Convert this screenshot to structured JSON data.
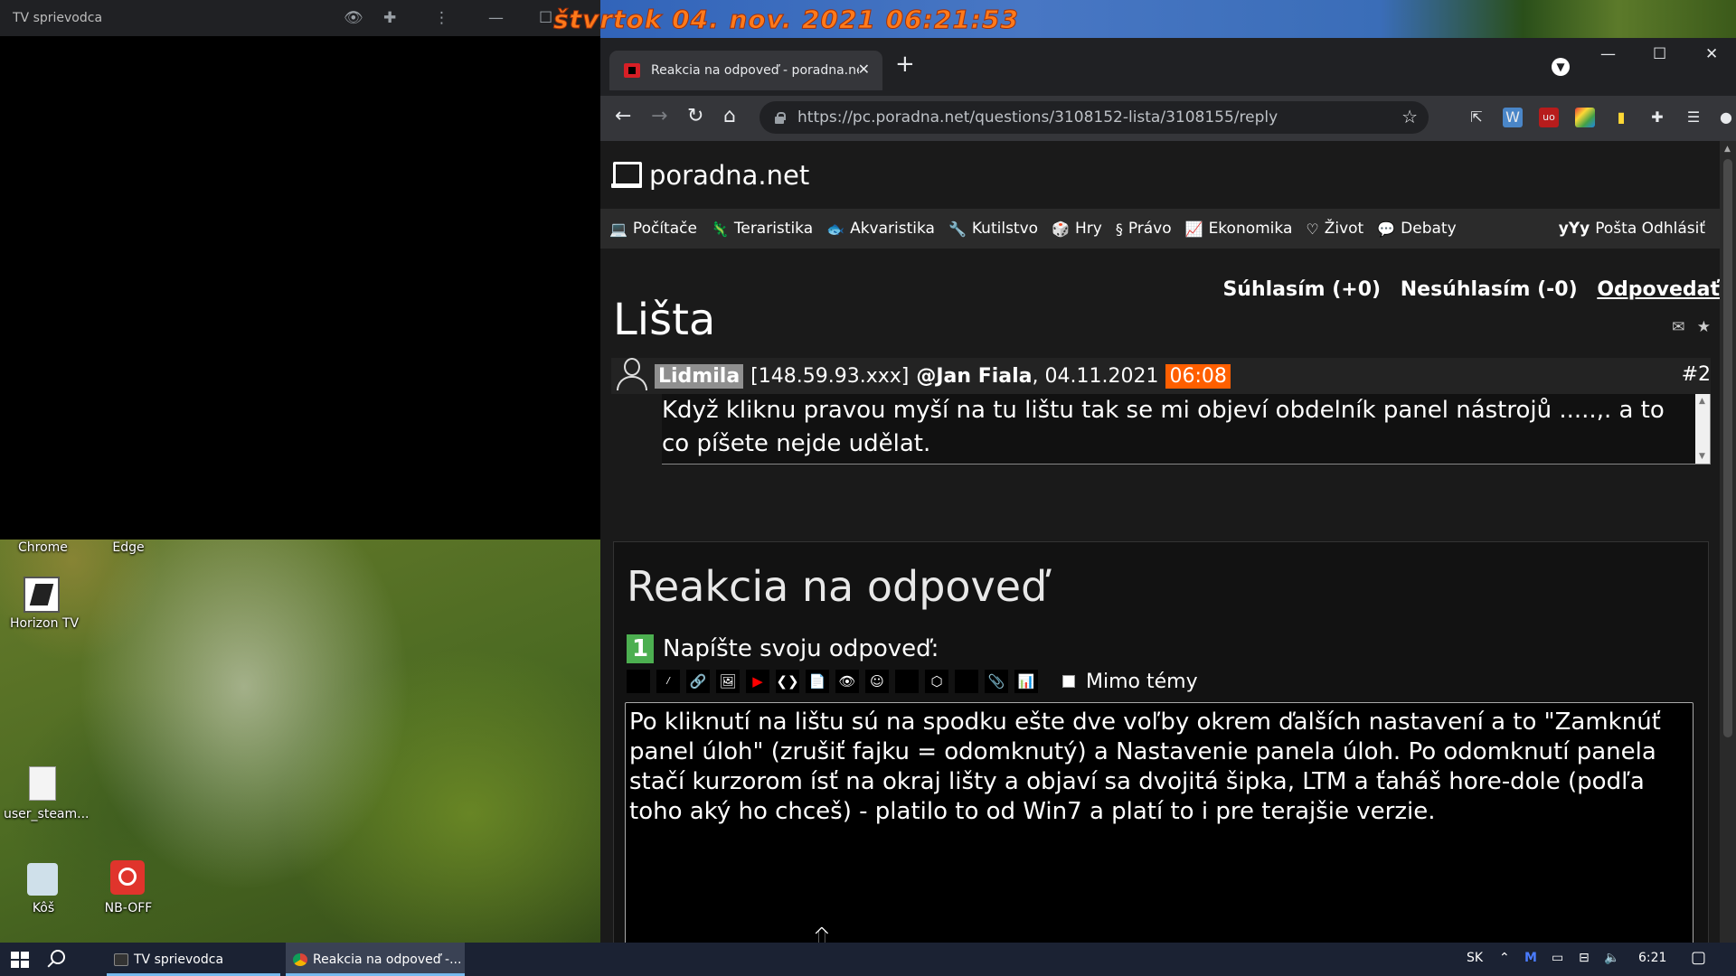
{
  "tv_window": {
    "title": "TV sprievodca"
  },
  "clock_overlay": "štvrtok 04. nov. 2021  06:21:53",
  "desktop_icons": [
    {
      "label": "Chrome"
    },
    {
      "label": "Edge"
    },
    {
      "label": "Horizon TV"
    },
    {
      "label": "user_steam..."
    },
    {
      "label": "Kôš"
    },
    {
      "label": "NB-OFF"
    }
  ],
  "browser": {
    "tab_title": "Reakcia na odpoveď - poradna.net",
    "url": "https://pc.poradna.net/questions/3108152-lista/3108155/reply"
  },
  "site": {
    "name": "poradna.net",
    "nav": [
      {
        "label": "Počítače",
        "icon": "💻"
      },
      {
        "label": "Teraristika",
        "icon": "🦎"
      },
      {
        "label": "Akvaristika",
        "icon": "🐟"
      },
      {
        "label": "Kutilstvo",
        "icon": "🔧"
      },
      {
        "label": "Hry",
        "icon": "🎲"
      },
      {
        "label": "Právo",
        "icon": "§"
      },
      {
        "label": "Ekonomika",
        "icon": "📈"
      },
      {
        "label": "Život",
        "icon": "♡"
      },
      {
        "label": "Debaty",
        "icon": "💬"
      }
    ],
    "user": {
      "name": "yYy",
      "mail": "Pošta",
      "logout": "Odhlásiť"
    }
  },
  "post": {
    "page_title": "Lišta",
    "author": "Lidmila",
    "ip": "[148.59.93.xxx]",
    "reply_to": "@Jan Fiala",
    "date": ", 04.11.2021",
    "time": "06:08",
    "number": "#2",
    "text": "Když kliknu pravou myší na tu lištu tak se mi objeví obdelník panel nástrojů .....,. a to co píšete nejde udělat.",
    "agree": "Súhlasím (+0)",
    "disagree": "Nesúhlasím (-0)",
    "reply": "Odpovedať"
  },
  "reply_form": {
    "title": "Reakcia na odpoveď",
    "step_number": "1",
    "step_label": "Napíšte svoju odpoveď:",
    "offtopic_label": "Mimo témy",
    "editor_text": "Po kliknutí na lištu sú na spodku ešte dve voľby okrem ďalších nastavení a to \"Zamknúť panel úloh\" (zrušiť fajku = odomknutý) a Nastavenie panela úloh. Po odomknutí panela stačí kurzorom ísť na okraj lišty a objaví sa dvojitá šipka, LTM a ťaháš hore-dole (podľa toho aký ho chceš) - platilo to od Win7 a platí to i pre terajšie verzie."
  },
  "taskbar": {
    "items": [
      {
        "label": "TV sprievodca"
      },
      {
        "label": "Reakcia na odpoveď -..."
      }
    ],
    "language": "SK",
    "time": "6:21"
  }
}
